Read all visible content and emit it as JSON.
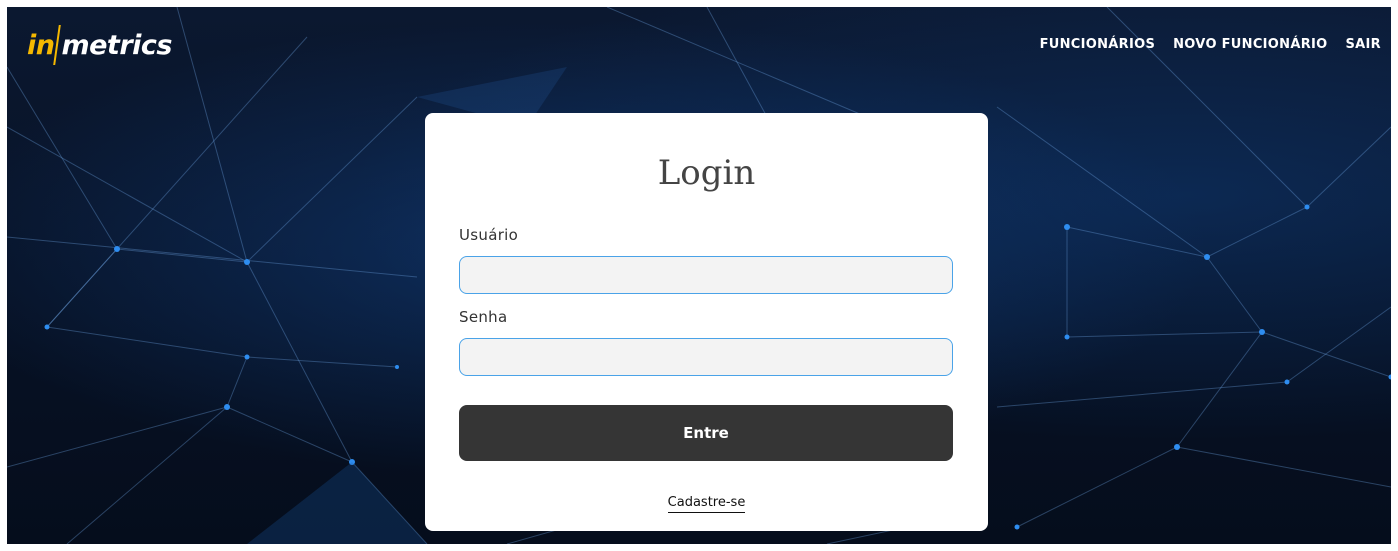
{
  "brand": {
    "prefix": "in",
    "suffix": "metrics"
  },
  "nav": {
    "items": [
      {
        "label": "FUNCIONÁRIOS"
      },
      {
        "label": "NOVO FUNCIONÁRIO"
      },
      {
        "label": "SAIR"
      }
    ]
  },
  "login": {
    "title": "Login",
    "username_label": "Usuário",
    "username_value": "",
    "password_label": "Senha",
    "password_value": "",
    "submit_label": "Entre",
    "register_link": "Cadastre-se"
  },
  "colors": {
    "brand_accent": "#f5b800",
    "input_border": "#4aa3e8",
    "button_bg": "#353535",
    "background": "#071226"
  },
  "icons": [
    "network-background-image"
  ]
}
